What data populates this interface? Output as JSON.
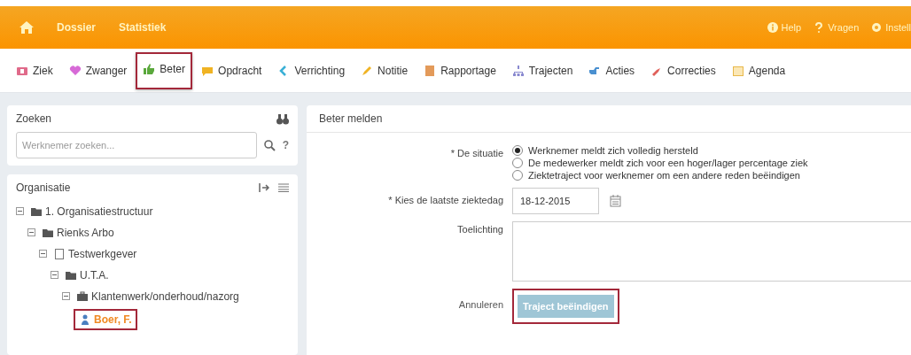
{
  "header": {
    "nav": [
      "Dossier",
      "Statistiek"
    ],
    "links": [
      {
        "kind": "info",
        "label": "Help"
      },
      {
        "kind": "question",
        "label": "Vragen"
      },
      {
        "kind": "gear",
        "label": "Instell"
      }
    ]
  },
  "toolbar": [
    {
      "kind": "ziek",
      "label": "Ziek",
      "highlighted": false
    },
    {
      "kind": "zwanger",
      "label": "Zwanger",
      "highlighted": false
    },
    {
      "kind": "beter",
      "label": "Beter",
      "highlighted": true
    },
    {
      "kind": "opdracht",
      "label": "Opdracht",
      "highlighted": false
    },
    {
      "kind": "verrichting",
      "label": "Verrichting",
      "highlighted": false
    },
    {
      "kind": "notitie",
      "label": "Notitie",
      "highlighted": false
    },
    {
      "kind": "rapportage",
      "label": "Rapportage",
      "highlighted": false
    },
    {
      "kind": "trajecten",
      "label": "Trajecten",
      "highlighted": false
    },
    {
      "kind": "acties",
      "label": "Acties",
      "highlighted": false
    },
    {
      "kind": "correcties",
      "label": "Correcties",
      "highlighted": false
    },
    {
      "kind": "agenda",
      "label": "Agenda",
      "highlighted": false
    }
  ],
  "search": {
    "title": "Zoeken",
    "placeholder": "Werknemer zoeken...",
    "help": "?"
  },
  "organisation": {
    "title": "Organisatie",
    "tree": [
      {
        "kind": "folder",
        "label": "1. Organisatiestructuur",
        "expanded": true,
        "highlighted": false,
        "children": [
          {
            "kind": "folder",
            "label": "Rienks Arbo",
            "expanded": true,
            "highlighted": false,
            "children": [
              {
                "kind": "page",
                "label": "Testwerkgever",
                "expanded": true,
                "highlighted": false,
                "children": [
                  {
                    "kind": "folder",
                    "label": "U.T.A.",
                    "expanded": true,
                    "highlighted": false,
                    "children": [
                      {
                        "kind": "briefcase",
                        "label": "Klantenwerk/onderhoud/nazorg",
                        "expanded": true,
                        "highlighted": false,
                        "children": [
                          {
                            "kind": "person",
                            "label": "Boer, F.",
                            "highlighted": true
                          }
                        ]
                      }
                    ]
                  }
                ]
              }
            ]
          }
        ]
      }
    ]
  },
  "form": {
    "title": "Beter melden",
    "situation": {
      "label": "* De situatie",
      "options": [
        {
          "label": "Werknemer meldt zich volledig hersteld",
          "selected": true
        },
        {
          "label": "De medewerker meldt zich voor een hoger/lager percentage ziek",
          "selected": false
        },
        {
          "label": "Ziektetraject voor werknemer om een andere reden beëindigen",
          "selected": false
        }
      ]
    },
    "date": {
      "label": "* Kies de laatste ziektedag",
      "value": "18-12-2015"
    },
    "note": {
      "label": "Toelichting"
    },
    "cancel": "Annuleren",
    "submit": {
      "label": "Traject beëindigen",
      "disabled": true,
      "highlighted": true
    }
  }
}
